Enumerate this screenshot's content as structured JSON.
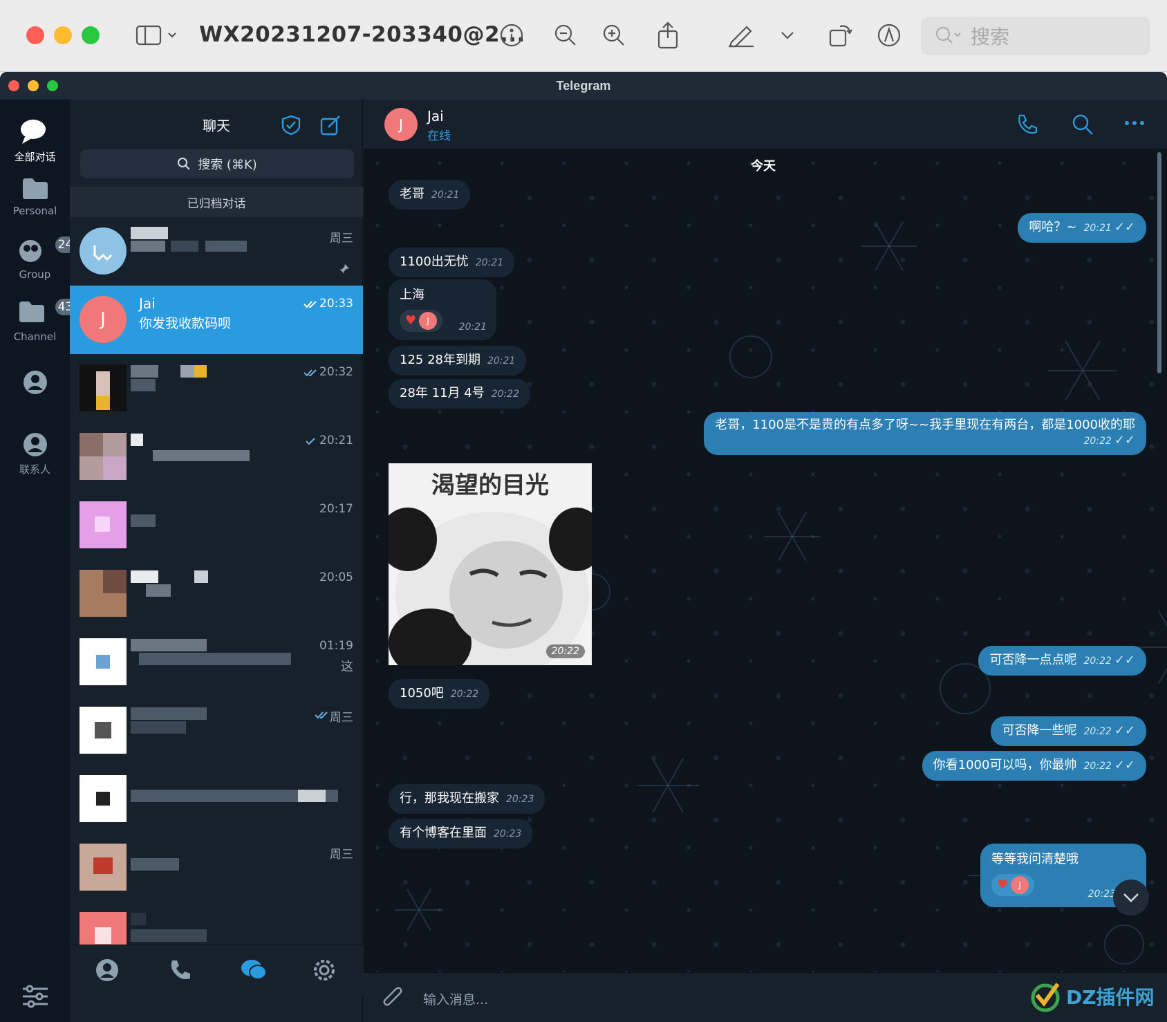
{
  "preview": {
    "doc_title": "WX20231207-203340@2...",
    "search_placeholder": "搜索"
  },
  "telegram": {
    "window_title": "Telegram",
    "rail": [
      {
        "label": "全部对话",
        "badge": ""
      },
      {
        "label": "Personal",
        "badge": ""
      },
      {
        "label": "Group",
        "badge": "24"
      },
      {
        "label": "Channel",
        "badge": "43"
      },
      {
        "label": "",
        "badge": ""
      },
      {
        "label": "联系人",
        "badge": ""
      }
    ],
    "chatlist": {
      "title": "聊天",
      "search": "搜索 (⌘K)",
      "archived": "已归档对话",
      "rows": [
        {
          "name": "",
          "msg": "",
          "time": "周三"
        },
        {
          "name": "Jai",
          "msg": "你发我收款码呗",
          "time": "20:33"
        },
        {
          "name": "",
          "msg": "",
          "time": "20:32"
        },
        {
          "name": "",
          "msg": "",
          "time": "20:21"
        },
        {
          "name": "",
          "msg": "",
          "time": "20:17"
        },
        {
          "name": "",
          "msg": "",
          "time": "20:05"
        },
        {
          "name": "",
          "msg": "这",
          "time": "01:19"
        },
        {
          "name": "",
          "msg": "",
          "time": "周三"
        },
        {
          "name": "",
          "msg": "",
          "time": ""
        },
        {
          "name": "",
          "msg": "",
          "time": "周三"
        },
        {
          "name": "",
          "msg": "",
          "time": ""
        }
      ]
    },
    "chat": {
      "contact_name": "Jai",
      "contact_status": "在线",
      "avatar_letter": "J",
      "date_label": "今天",
      "sticker_caption": "渴望的目光",
      "sticker_time": "20:22",
      "messages": [
        {
          "dir": "in",
          "text": "老哥",
          "time": "20:21"
        },
        {
          "dir": "out",
          "text": "啊哈？~",
          "time": "20:21"
        },
        {
          "dir": "in",
          "text": "1100出无忧",
          "time": "20:21"
        },
        {
          "dir": "in",
          "text": "上海",
          "time": "20:21",
          "reaction": true
        },
        {
          "dir": "in",
          "text": "125 28年到期",
          "time": "20:21"
        },
        {
          "dir": "in",
          "text": "28年 11月 4号",
          "time": "20:22"
        },
        {
          "dir": "out",
          "text": "老哥，1100是不是贵的有点多了呀~~我手里现在有两台，都是1000收的耶",
          "time": "20:22"
        },
        {
          "dir": "out",
          "text": "可否降一点点呢",
          "time": "20:22"
        },
        {
          "dir": "in",
          "text": "1050吧",
          "time": "20:22"
        },
        {
          "dir": "out",
          "text": "可否降一些呢",
          "time": "20:22"
        },
        {
          "dir": "out",
          "text": "你看1000可以吗，你最帅",
          "time": "20:22"
        },
        {
          "dir": "in",
          "text": "行，那我现在搬家",
          "time": "20:23"
        },
        {
          "dir": "in",
          "text": "有个博客在里面",
          "time": "20:23"
        },
        {
          "dir": "out",
          "text": "等等我问清楚哦",
          "time": "20:23",
          "reaction": true
        }
      ],
      "composer_placeholder": "输入消息...",
      "watermark": "DZ插件网"
    },
    "colors": {
      "accent": "#2b9be0",
      "out_bubble": "#2b7fb3",
      "in_bubble": "#182533",
      "avatar": "#f07878"
    }
  }
}
